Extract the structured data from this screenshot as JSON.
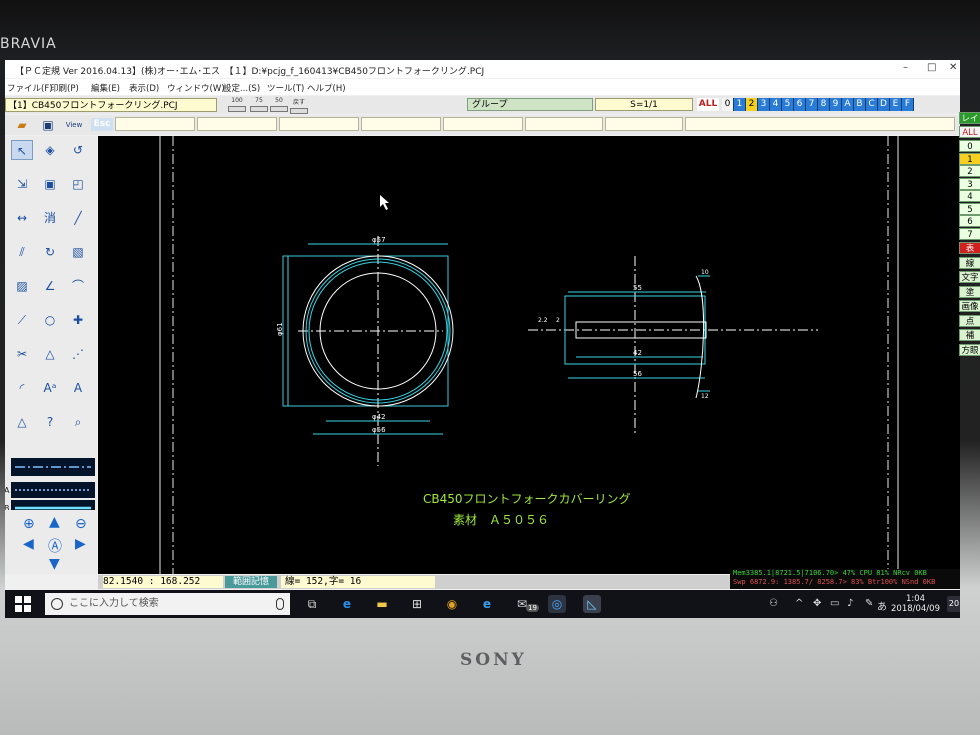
{
  "tv": {
    "brand_top": "BRAVIA",
    "brand_bottom": "SONY"
  },
  "titlebar": {
    "title": "【ＰＣ定規 Ver 2016.04.13】(株)オー･エム･エス　【１】D:¥pcjg_f_160413¥CB450フロントフォークリング.PCJ",
    "min": "–",
    "max": "□",
    "close": "✕"
  },
  "menu": [
    "ファイル(F)",
    "印刷(P)",
    "編集(E)",
    "表示(D)",
    "ウィンドウ(W)",
    "設定...(S)",
    "ツール(T)",
    "ヘルプ(H)"
  ],
  "toolbar": {
    "filename": "【1】CB450フロントフォークリング.PCJ",
    "buttons": [
      "100",
      "75",
      "50",
      "戻す"
    ],
    "group_label": "グループ",
    "scale": "S=1/1",
    "all": "ALL",
    "layers": [
      "0",
      "1",
      "2",
      "3",
      "4",
      "5",
      "6",
      "7",
      "8",
      "9",
      "A",
      "B",
      "C",
      "D",
      "E",
      "F"
    ],
    "esc": "Esc",
    "view": "View"
  },
  "left_tools": {
    "rows": [
      [
        "pointer-icon",
        "paint-bucket-icon",
        "undo-icon"
      ],
      [
        "move-icon",
        "select-box-icon",
        "rect-corner-icon"
      ],
      [
        "dimension-arrows-icon",
        "erase-icon",
        "line-icon"
      ],
      [
        "parallel-icon",
        "rotate-icon",
        "image-icon"
      ],
      [
        "hatch-icon",
        "angle-icon",
        "fillet-icon"
      ],
      [
        "polyline-icon",
        "circle-icon",
        "point-icon"
      ],
      [
        "trim-icon",
        "triangle-icon",
        "chamfer-icon"
      ],
      [
        "arc-icon",
        "text-size-icon",
        "text-icon"
      ],
      [
        "hexagon-icon",
        "help-icon",
        "magnify-icon"
      ]
    ],
    "glyphs": [
      [
        "↖",
        "◈",
        "↺"
      ],
      [
        "⇲",
        "▣",
        "◰"
      ],
      [
        "↔",
        "消",
        "╱"
      ],
      [
        "⫽",
        "↻",
        "▧"
      ],
      [
        "▨",
        "∠",
        "⌒"
      ],
      [
        "⟋",
        "○",
        "✚"
      ],
      [
        "✂",
        "△",
        "⋰"
      ],
      [
        "◜",
        "Aᵃ",
        "A"
      ],
      [
        "△",
        "?",
        "⌕"
      ]
    ],
    "line_letters": [
      "A",
      "B",
      "C",
      "D",
      "E"
    ]
  },
  "drawing": {
    "front_view": {
      "dia_outer": "φ61",
      "dia_top": "φ57",
      "dia_mid": "φ42",
      "dia_bottom": "φ56"
    },
    "side_view": {
      "dim_top": "55",
      "dim_mid": "42",
      "dim_bottom": "56",
      "dim_small_top": "10",
      "dim_small_bottom": "12",
      "dim_left": "2.2",
      "dim_left2": "2"
    },
    "title_line1": "CB450フロントフォークカバーリング",
    "title_line2": "素材　Ａ５０５６"
  },
  "right_panel": {
    "label_top": "レイ",
    "all": "ALL",
    "layers": [
      "0",
      "1",
      "2",
      "3",
      "4",
      "5",
      "6",
      "7"
    ],
    "modes": [
      "表",
      "線",
      "文字",
      "塗",
      "画像",
      "点",
      "補",
      "方眼"
    ]
  },
  "statusbar": {
    "coord": "82.1540 : 168.252",
    "range": "範囲記憶",
    "count": "線= 152,字=  16"
  },
  "sysinfo": {
    "line1": "Mem3385.1|8721.5|7106.70> 47% CPU 81% NRcv  0KB",
    "line2": "Swp 6872.9: 1385.7/ 8258.7> 83% Btr100% NSnd  0KB"
  },
  "taskbar": {
    "search_placeholder": "ここに入力して検索",
    "time": "1:04",
    "date": "2018/04/09",
    "notifications": "20",
    "mail_badge": "19"
  }
}
